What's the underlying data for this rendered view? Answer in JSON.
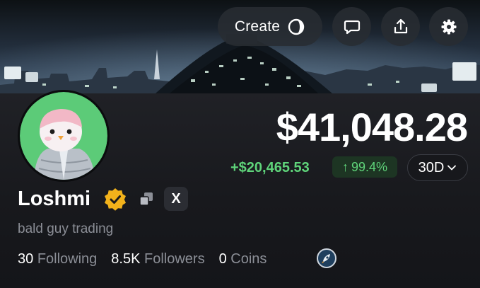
{
  "header": {
    "create_label": "Create",
    "icons": [
      "create-icon",
      "chat-icon",
      "share-icon",
      "gear-icon"
    ]
  },
  "profile": {
    "username": "Loshmi",
    "bio": "bald guy trading",
    "verified": true,
    "social_label": "X"
  },
  "portfolio": {
    "balance": "$41,048.28",
    "pnl": "+$20,465.53",
    "pnl_percent": "99.4%",
    "pnl_arrow": "↑",
    "period": "30D",
    "period_caret": "⌄"
  },
  "stats": {
    "following_count": "30",
    "following_label": "Following",
    "followers_count": "8.5K",
    "followers_label": "Followers",
    "coins_count": "0",
    "coins_label": "Coins"
  },
  "colors": {
    "background": "#141519",
    "positive": "#5fd47a",
    "verified_badge": "#f2b21b",
    "muted_text": "#8b8e96",
    "avatar_bg": "#5ccb78"
  }
}
